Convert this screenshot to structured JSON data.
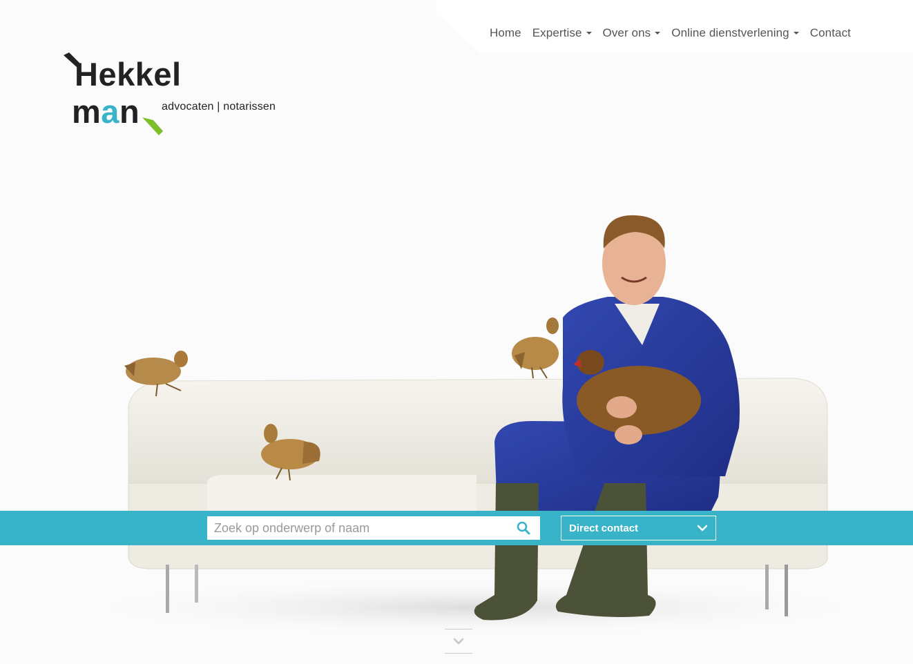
{
  "nav": {
    "items": [
      {
        "label": "Home",
        "dropdown": false
      },
      {
        "label": "Expertise",
        "dropdown": true
      },
      {
        "label": "Over ons",
        "dropdown": true
      },
      {
        "label": "Online dienstverlening",
        "dropdown": true
      },
      {
        "label": "Contact",
        "dropdown": false
      }
    ]
  },
  "logo": {
    "line1": "Hekkel",
    "line2_m": "m",
    "line2_a": "a",
    "line2_n": "n",
    "tagline": "advocaten | notarissen"
  },
  "search": {
    "placeholder": "Zoek op onderwerp of naam",
    "icon": "search-icon"
  },
  "contact_select": {
    "label": "Direct contact",
    "icon": "chevron-down-icon"
  },
  "scroll": {
    "icon": "chevron-down-icon"
  },
  "colors": {
    "accent": "#39b3c7",
    "logo_green": "#7cbf2a",
    "text_dark": "#222222",
    "nav_text": "#555555"
  }
}
